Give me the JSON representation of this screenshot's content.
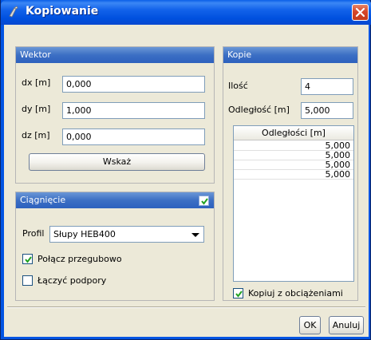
{
  "window": {
    "title": "Kopiowanie"
  },
  "wektor": {
    "header": "Wektor",
    "dx_label": "dx [m]",
    "dx_value": "0,000",
    "dy_label": "dy [m]",
    "dy_value": "1,000",
    "dz_label": "dz [m]",
    "dz_value": "0,000",
    "pick_button": "Wskaż"
  },
  "ciagniecie": {
    "header": "Ciągnięcie",
    "enabled": true,
    "profile_label": "Profil",
    "profile_value": "Słupy HEB400",
    "hinged_label": "Połącz przegubowo",
    "hinged_checked": true,
    "supports_label": "Łączyć podpory",
    "supports_checked": false
  },
  "kopie": {
    "header": "Kopie",
    "count_label": "Ilość",
    "count_value": "4",
    "distance_label": "Odległość [m]",
    "distance_value": "5,000",
    "table_header": "Odległości [m]",
    "rows": [
      "5,000",
      "5,000",
      "5,000",
      "5,000"
    ],
    "with_loads_label": "Kopiuj z obciążeniami",
    "with_loads_checked": true
  },
  "footer": {
    "ok_label": "OK",
    "cancel_label": "Anuluj"
  },
  "colors": {
    "titlebar": "#0054e3",
    "panel_header": "#3c6fc4",
    "dialog_bg": "#ece9d8",
    "close": "#d6462a"
  }
}
